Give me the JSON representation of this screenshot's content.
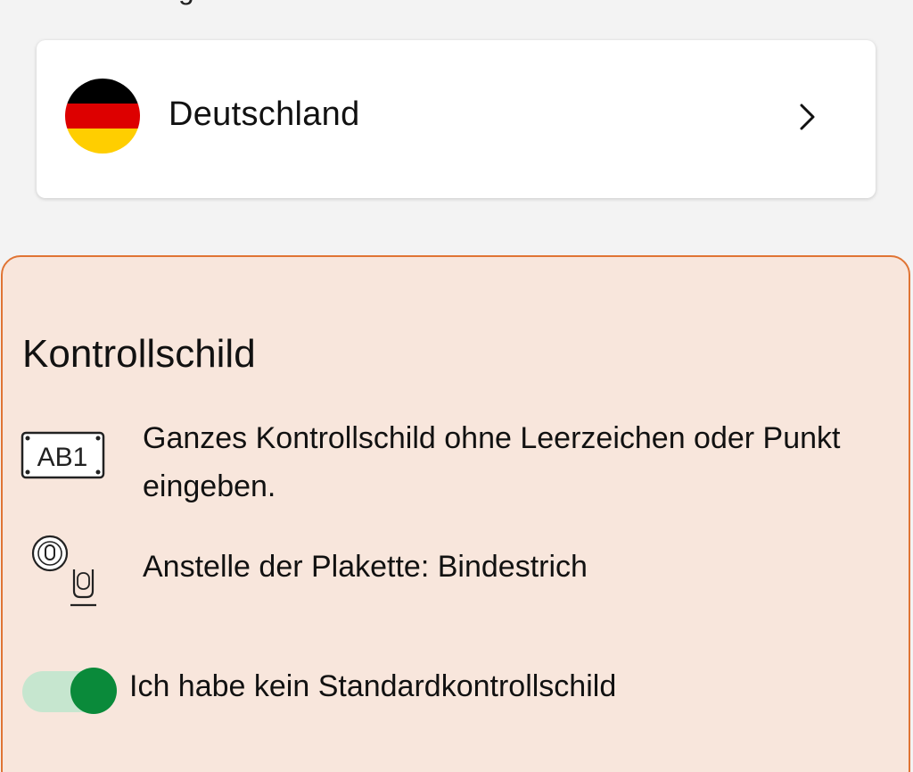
{
  "header": {
    "hint_text": "g"
  },
  "country": {
    "name": "Deutschland",
    "flag_icon": "flag-germany-icon",
    "flag_colors": [
      "#000000",
      "#dd0000",
      "#ffce00"
    ],
    "chevron_icon": "chevron-right-icon"
  },
  "plate_section": {
    "title": "Kontrollschild",
    "accent_color": "#e07434",
    "background_color": "#f8e6dc",
    "plate_icon_text": "AB1",
    "info_items": [
      {
        "icon": "license-plate-icon",
        "text": "Ganzes Kontrollschild ohne Leerzeichen oder Punkt eingeben."
      },
      {
        "icon": "plaque-hyphen-icon",
        "text": "Anstelle der Plakette: Bindestrich"
      }
    ],
    "toggle": {
      "label": "Ich habe kein Standardkontrollschild",
      "checked": true,
      "on_color": "#0a8a3a"
    }
  }
}
